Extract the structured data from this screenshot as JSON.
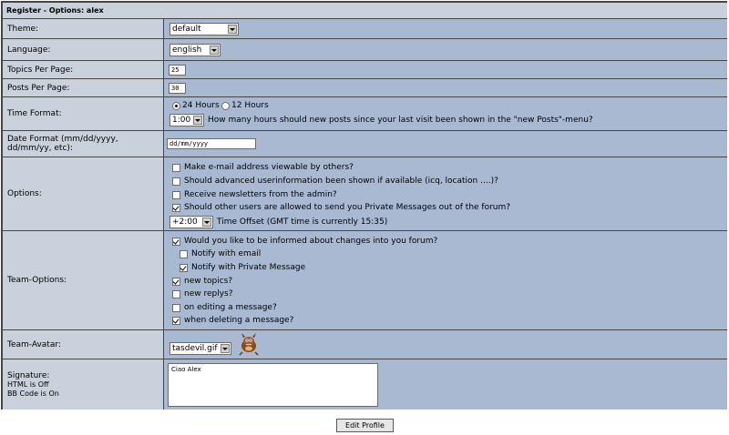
{
  "header": {
    "title": "Register - Options:  alex"
  },
  "theme": {
    "label": "Theme:",
    "value": "default"
  },
  "language": {
    "label": "Language:",
    "value": "english"
  },
  "topics_per_page": {
    "label": "Topics Per Page:",
    "value": "25"
  },
  "posts_per_page": {
    "label": "Posts Per Page:",
    "value": "30"
  },
  "time_format": {
    "label": "Time Format:",
    "opt24": "24 Hours",
    "opt12": "12 Hours",
    "hours_value": "1:00",
    "hours_text": "How many hours should new posts since your last visit been shown in the \"new Posts\"-menu?"
  },
  "date_format": {
    "label": "Date Format (mm/dd/yyyy, dd/mm/yy, etc):",
    "value": "dd/mm/yyyy"
  },
  "options": {
    "label": "Options:",
    "items": [
      "Make e-mail address viewable by others?",
      "Should advanced userinformation been shown if available (icq, location ....)?",
      "Receive newsletters from the admin?",
      "Should other users are allowed to send you Private Messages out of the forum?"
    ],
    "offset_value": "+2:00",
    "offset_text": "Time Offset (GMT time is currently 15:35)"
  },
  "team_options": {
    "label": "Team-Options:",
    "main": "Would you like to be informed about changes into you forum?",
    "notify_email": "Notify with email",
    "notify_pm": "Notify with Private Message",
    "new_topics": "new topics?",
    "new_replys": "new replys?",
    "on_editing": "on editing a message?",
    "when_deleting": "when deleting a message?"
  },
  "team_avatar": {
    "label": "Team-Avatar:",
    "value": "tasdevil.gif"
  },
  "signature": {
    "label": "Signature:",
    "html": "HTML is Off",
    "bbcode": "BB Code is On",
    "value": "Ciao Alex"
  },
  "submit": {
    "label": "Edit Profile"
  }
}
